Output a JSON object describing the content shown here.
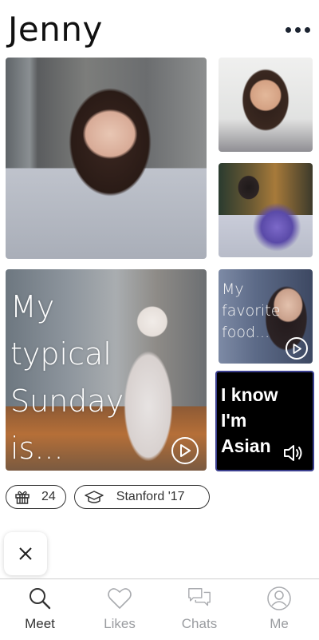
{
  "header": {
    "name": "Jenny"
  },
  "tiles": {
    "sunday_prompt": "My\ntypical\nSunday\nis...",
    "food_prompt": "My\nfavorite\nfood...",
    "audio_prompt": "I know\nI'm\nAsian"
  },
  "chips": {
    "gift_count": "24",
    "school": "Stanford '17"
  },
  "tabs": [
    {
      "label": "Meet",
      "icon": "search-icon"
    },
    {
      "label": "Likes",
      "icon": "heart-icon"
    },
    {
      "label": "Chats",
      "icon": "chat-icon"
    },
    {
      "label": "Me",
      "icon": "user-icon"
    }
  ],
  "colors": {
    "active_tab": "#333333",
    "inactive_tab": "#9a9ca0",
    "audio_tile_bg": "#000000",
    "audio_tile_border": "#3b3f8f"
  }
}
